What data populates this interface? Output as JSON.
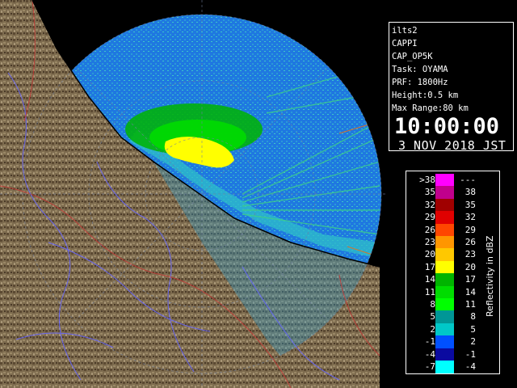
{
  "info": {
    "station": "ilts2",
    "product": "CAPPI",
    "operation": "CAP_OP5K",
    "task": "Task: OYAMA",
    "prf": "PRF: 1800Hz",
    "height": "Height:0.5 km",
    "max_range": "Max Range:80 km",
    "time": "10:00:00",
    "date": "3 NOV 2018 JST"
  },
  "legend": {
    "title": "Reflectivity in dBZ",
    "rows": [
      {
        "low": ">38",
        "high": "---",
        "color": "#ff00ff"
      },
      {
        "low": "35",
        "high": "38",
        "color": "#c0008c"
      },
      {
        "low": "32",
        "high": "35",
        "color": "#a00000"
      },
      {
        "low": "29",
        "high": "32",
        "color": "#e00000"
      },
      {
        "low": "26",
        "high": "29",
        "color": "#ff4600"
      },
      {
        "low": "23",
        "high": "26",
        "color": "#ff9600"
      },
      {
        "low": "20",
        "high": "23",
        "color": "#ffc800"
      },
      {
        "low": "17",
        "high": "20",
        "color": "#ffff00"
      },
      {
        "low": "14",
        "high": "17",
        "color": "#00b400"
      },
      {
        "low": "11",
        "high": "14",
        "color": "#00dc00"
      },
      {
        "low": "8",
        "high": "11",
        "color": "#00ff00"
      },
      {
        "low": "5",
        "high": "8",
        "color": "#009696"
      },
      {
        "low": "2",
        "high": "5",
        "color": "#00c8c8"
      },
      {
        "low": "-1",
        "high": "2",
        "color": "#0050ff"
      },
      {
        "low": "-4",
        "high": "-1",
        "color": "#0a0aa0"
      },
      {
        "low": "-7",
        "high": "-4",
        "color": "#00ffff"
      }
    ]
  },
  "colors": {
    "land": "#7a6a4e",
    "sea_echo": "#1e7ae6",
    "river": "#6464ff",
    "boundary": "#c83232"
  }
}
